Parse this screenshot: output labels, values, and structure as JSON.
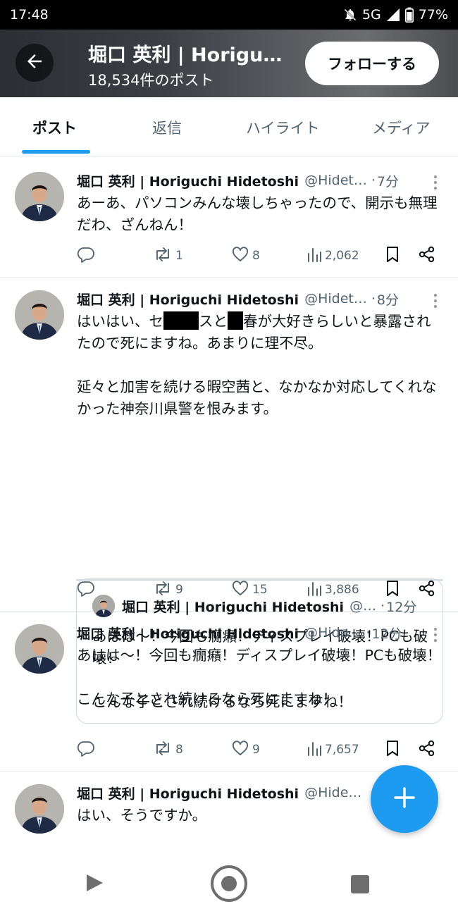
{
  "status_bar": {
    "time": "17:48",
    "network": "5G",
    "battery": "77%"
  },
  "header": {
    "title": "堀口 英利 | Horiguchi Hidetoshi",
    "post_count": "18,534件のポスト",
    "follow_label": "フォローする"
  },
  "tabs": [
    {
      "label": "ポスト",
      "active": true
    },
    {
      "label": "返信",
      "active": false
    },
    {
      "label": "ハイライト",
      "active": false
    },
    {
      "label": "メディア",
      "active": false
    }
  ],
  "posts": [
    {
      "name": "堀口 英利 | Horiguchi Hidetoshi",
      "handle": "@Hidet…",
      "time": "7分",
      "lines": [
        "あーあ、パソコンみんな壊しちゃったので、開示も無理だわ、ざんねん！"
      ],
      "replies": "",
      "reposts": "1",
      "likes": "8",
      "views": "2,062"
    },
    {
      "name": "堀口 英利 | Horiguchi Hidetoshi",
      "handle": "@Hidet…",
      "time": "8分",
      "text_a": "はいはい、セ",
      "text_b": "ス",
      "text_c": "と",
      "text_d": "春が大好きらしいと暴露されたので死にますね。あまりに理不尽。",
      "text_2": "延々と加害を続ける暇空茜と、なかなか対応してくれなかった神奈川県警を恨みます。",
      "quote": {
        "name": "堀口 英利 | Horiguchi Hidetoshi",
        "handle": "@…",
        "time": "12分",
        "line1": "あはは〜！今回も癇癪！ディスプレイ破壊！PCも破壊！",
        "line2": "こんな子とされ続けるなら死にますね！"
      },
      "replies": "",
      "reposts": "9",
      "likes": "15",
      "views": "3,886"
    },
    {
      "name": "堀口 英利 | Horiguchi Hidetoshi",
      "handle": "@Hide…",
      "time": "12分",
      "line1": "あはは〜！今回も癇癪！ディスプレイ破壊！PCも破壊！",
      "line2": "こんな子とされ続けるなら死にますね！",
      "replies": "",
      "reposts": "8",
      "likes": "9",
      "views": "7,657"
    },
    {
      "name": "堀口 英利 | Horiguchi Hidetoshi",
      "handle": "@Hide…",
      "line1": "はい、そうですか。"
    }
  ],
  "colors": {
    "accent": "#1d9bf0",
    "text": "#0f1419",
    "secondary": "#536471"
  }
}
